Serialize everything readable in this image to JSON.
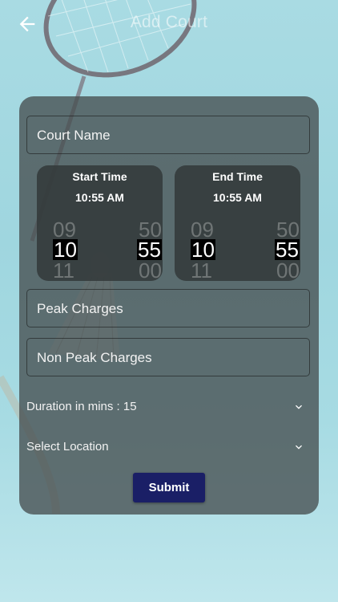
{
  "header": {
    "title": "Add Court"
  },
  "form": {
    "court_name_placeholder": "Court Name",
    "peak_charges_placeholder": "Peak Charges",
    "non_peak_charges_placeholder": "Non Peak Charges",
    "duration_label": "Duration in mins : 15",
    "location_label": "Select Location",
    "submit_label": "Submit"
  },
  "start_time": {
    "title": "Start Time",
    "value": "10:55 AM",
    "hours": [
      "09",
      "10",
      "11"
    ],
    "minutes": [
      "50",
      "55",
      "00"
    ]
  },
  "end_time": {
    "title": "End Time",
    "value": "10:55 AM",
    "hours": [
      "09",
      "10",
      "11"
    ],
    "minutes": [
      "50",
      "55",
      "00"
    ]
  },
  "colors": {
    "accent": "#1a1f66",
    "card": "#464e50"
  }
}
